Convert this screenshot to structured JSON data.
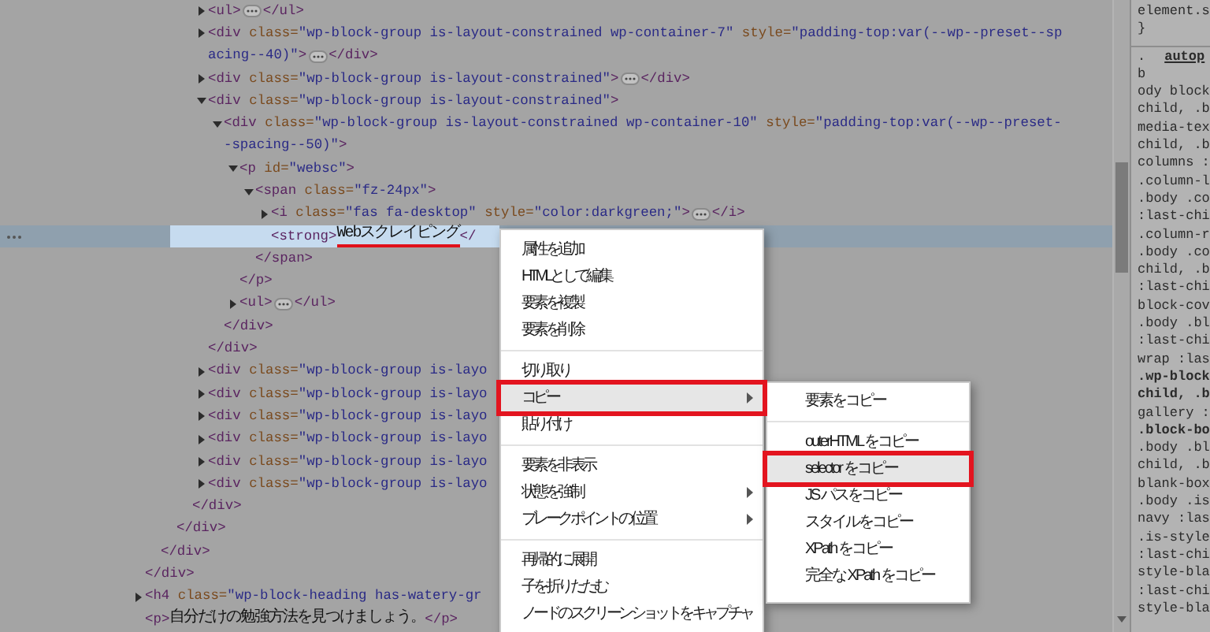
{
  "elements_tree": [
    {
      "selected": false,
      "close": "</div>",
      "children": [
        {
          "selected": false,
          "close": "</div>",
          "children": [
            {
              "selected": false,
              "close": "</div>",
              "children": [
                {
                  "selected": false,
                  "close": "</div>",
                  "children": [
                    {
                      "open": [
                        "<ul>"
                      ],
                      "close": "</ul>",
                      "expanded": false,
                      "selected": false
                    },
                    {
                      "open": [
                        "<div class=\"wp-block-group is-layout-constrained wp-container-7\" style=\"padding-top:var(--wp--preset--sp",
                        "acing--40)\">"
                      ],
                      "close": "</div>",
                      "expanded": false,
                      "selected": false
                    },
                    {
                      "open": [
                        "<div class=\"wp-block-group is-layout-constrained\">"
                      ],
                      "close": "</div>",
                      "expanded": false,
                      "selected": false
                    },
                    {
                      "open": [
                        "<div class=\"wp-block-group is-layout-constrained\">"
                      ],
                      "close": "</div>",
                      "expanded": true,
                      "selected": false,
                      "children": [
                        {
                          "open": [
                            "<div class=\"wp-block-group is-layout-constrained wp-container-10\" style=\"padding-top:var(--wp--preset-",
                            "-spacing--50)\">"
                          ],
                          "close": "</div>",
                          "expanded": true,
                          "selected": false,
                          "children": [
                            {
                              "open": [
                                "<p id=\"websc\">"
                              ],
                              "close": "</p>",
                              "expanded": true,
                              "selected": false,
                              "children": [
                                {
                                  "open": [
                                    "<span class=\"fz-24px\">"
                                  ],
                                  "close": "</span>",
                                  "expanded": true,
                                  "selected": false,
                                  "children": [
                                    {
                                      "open": [
                                        "<i class=\"fas fa-desktop\" style=\"color:darkgreen;\">"
                                      ],
                                      "close": "</i>",
                                      "expanded": false,
                                      "selected": false
                                    },
                                    {
                                      "open": [
                                        "<strong>"
                                      ],
                                      "text": "Webスクレイピング",
                                      "close": "</",
                                      "selected": true,
                                      "underlined": true
                                    }
                                  ]
                                }
                              ]
                            },
                            {
                              "open": [
                                "<ul>"
                              ],
                              "close": "</ul>",
                              "expanded": false,
                              "selected": false
                            }
                          ]
                        }
                      ]
                    },
                    {
                      "open": [
                        "<div class=\"wp-block-group is-layo"
                      ],
                      "expanded": false,
                      "selected": false
                    },
                    {
                      "open": [
                        "<div class=\"wp-block-group is-layo"
                      ],
                      "expanded": false,
                      "selected": false
                    },
                    {
                      "open": [
                        "<div class=\"wp-block-group is-layo"
                      ],
                      "expanded": false,
                      "selected": false
                    },
                    {
                      "open": [
                        "<div class=\"wp-block-group is-layo"
                      ],
                      "expanded": false,
                      "selected": false
                    },
                    {
                      "open": [
                        "<div class=\"wp-block-group is-layo"
                      ],
                      "expanded": false,
                      "selected": false
                    },
                    {
                      "open": [
                        "<div class=\"wp-block-group is-layo"
                      ],
                      "expanded": false,
                      "selected": false
                    }
                  ]
                }
              ]
            }
          ]
        }
      ]
    },
    {
      "open": [
        "<h4 class=\"wp-block-heading has-watery-gr"
      ],
      "expanded": false,
      "selected": false
    },
    {
      "open": [
        "<p>"
      ],
      "text": "自分だけの勉強方法を見つけましょう。",
      "close": "</p>",
      "selected": false
    }
  ],
  "styles_pane": {
    "header_lines": [
      "element.s",
      "}"
    ],
    "source": {
      "prefix": ".",
      "link": "autop"
    },
    "lines": [
      {
        "text": "b",
        "bold": false
      },
      {
        "text": "ody block",
        "bold": false
      },
      {
        "text": "child, .b",
        "bold": false
      },
      {
        "text": "media-tex",
        "bold": false
      },
      {
        "text": "child, .b",
        "bold": false
      },
      {
        "text": "columns :",
        "bold": false
      },
      {
        "text": ".column-l",
        "bold": false
      },
      {
        "text": ".body .co",
        "bold": false
      },
      {
        "text": ":last-chi",
        "bold": false
      },
      {
        "text": ".column-r",
        "bold": false
      },
      {
        "text": ".body .co",
        "bold": false
      },
      {
        "text": "child, .b",
        "bold": false
      },
      {
        "text": ":last-chi",
        "bold": false
      },
      {
        "text": "block-cov",
        "bold": false
      },
      {
        "text": ".body .bl",
        "bold": false
      },
      {
        "text": ":last-chi",
        "bold": false
      },
      {
        "text": "wrap :las",
        "bold": false
      },
      {
        "text": ".wp-block",
        "bold": true
      },
      {
        "text": "child, .b",
        "bold": true
      },
      {
        "text": "gallery :",
        "bold": false
      },
      {
        "text": ".block-bo",
        "bold": true
      },
      {
        "text": ".body .bl",
        "bold": false
      },
      {
        "text": "child, .b",
        "bold": false
      },
      {
        "text": "blank-box",
        "bold": false
      },
      {
        "text": ".body .is",
        "bold": false
      },
      {
        "text": "navy :las",
        "bold": false
      },
      {
        "text": ".is-style",
        "bold": false
      },
      {
        "text": ":last-chi",
        "bold": false
      },
      {
        "text": "style-bla",
        "bold": false
      },
      {
        "text": ":last-chi",
        "bold": false
      },
      {
        "text": "style-bla",
        "bold": false
      }
    ]
  },
  "context_menu": {
    "groups": [
      [
        {
          "label": "属性を追加",
          "selected": false,
          "outlined": false,
          "has_submenu": false
        },
        {
          "label": "HTML として編集",
          "selected": false,
          "outlined": false,
          "has_submenu": false
        },
        {
          "label": "要素を複製",
          "selected": false,
          "outlined": false,
          "has_submenu": false
        },
        {
          "label": "要素を削除",
          "selected": false,
          "outlined": false,
          "has_submenu": false
        }
      ],
      [
        {
          "label": "切り取り",
          "selected": false,
          "outlined": false,
          "has_submenu": false
        },
        {
          "label": "コピー",
          "selected": true,
          "outlined": true,
          "has_submenu": true
        },
        {
          "label": "貼り付け",
          "selected": false,
          "outlined": false,
          "has_submenu": false
        }
      ],
      [
        {
          "label": "要素を非表示",
          "selected": false,
          "outlined": false,
          "has_submenu": false
        },
        {
          "label": "状態を強制",
          "selected": false,
          "outlined": false,
          "has_submenu": true
        },
        {
          "label": "ブレークポイントの位置",
          "selected": false,
          "outlined": false,
          "has_submenu": true
        }
      ],
      [
        {
          "label": "再帰的に展開",
          "selected": false,
          "outlined": false,
          "has_submenu": false
        },
        {
          "label": "子を折りたたむ",
          "selected": false,
          "outlined": false,
          "has_submenu": false
        },
        {
          "label": "ノードのスクリーンショットをキャプチャ",
          "selected": false,
          "outlined": false,
          "has_submenu": false
        }
      ]
    ]
  },
  "copy_submenu": {
    "groups": [
      [
        {
          "label": "要素をコピー",
          "selected": false,
          "outlined": false
        }
      ],
      [
        {
          "label": "outerHTML をコピー",
          "selected": false,
          "outlined": false
        },
        {
          "label": "selector をコピー",
          "selected": true,
          "outlined": true
        },
        {
          "label": "JS パスをコピー",
          "selected": false,
          "outlined": false
        },
        {
          "label": "スタイルをコピー",
          "selected": false,
          "outlined": false
        },
        {
          "label": "XPath をコピー",
          "selected": false,
          "outlined": false
        },
        {
          "label": "完全な XPath をコピー",
          "selected": false,
          "outlined": false
        }
      ]
    ]
  }
}
